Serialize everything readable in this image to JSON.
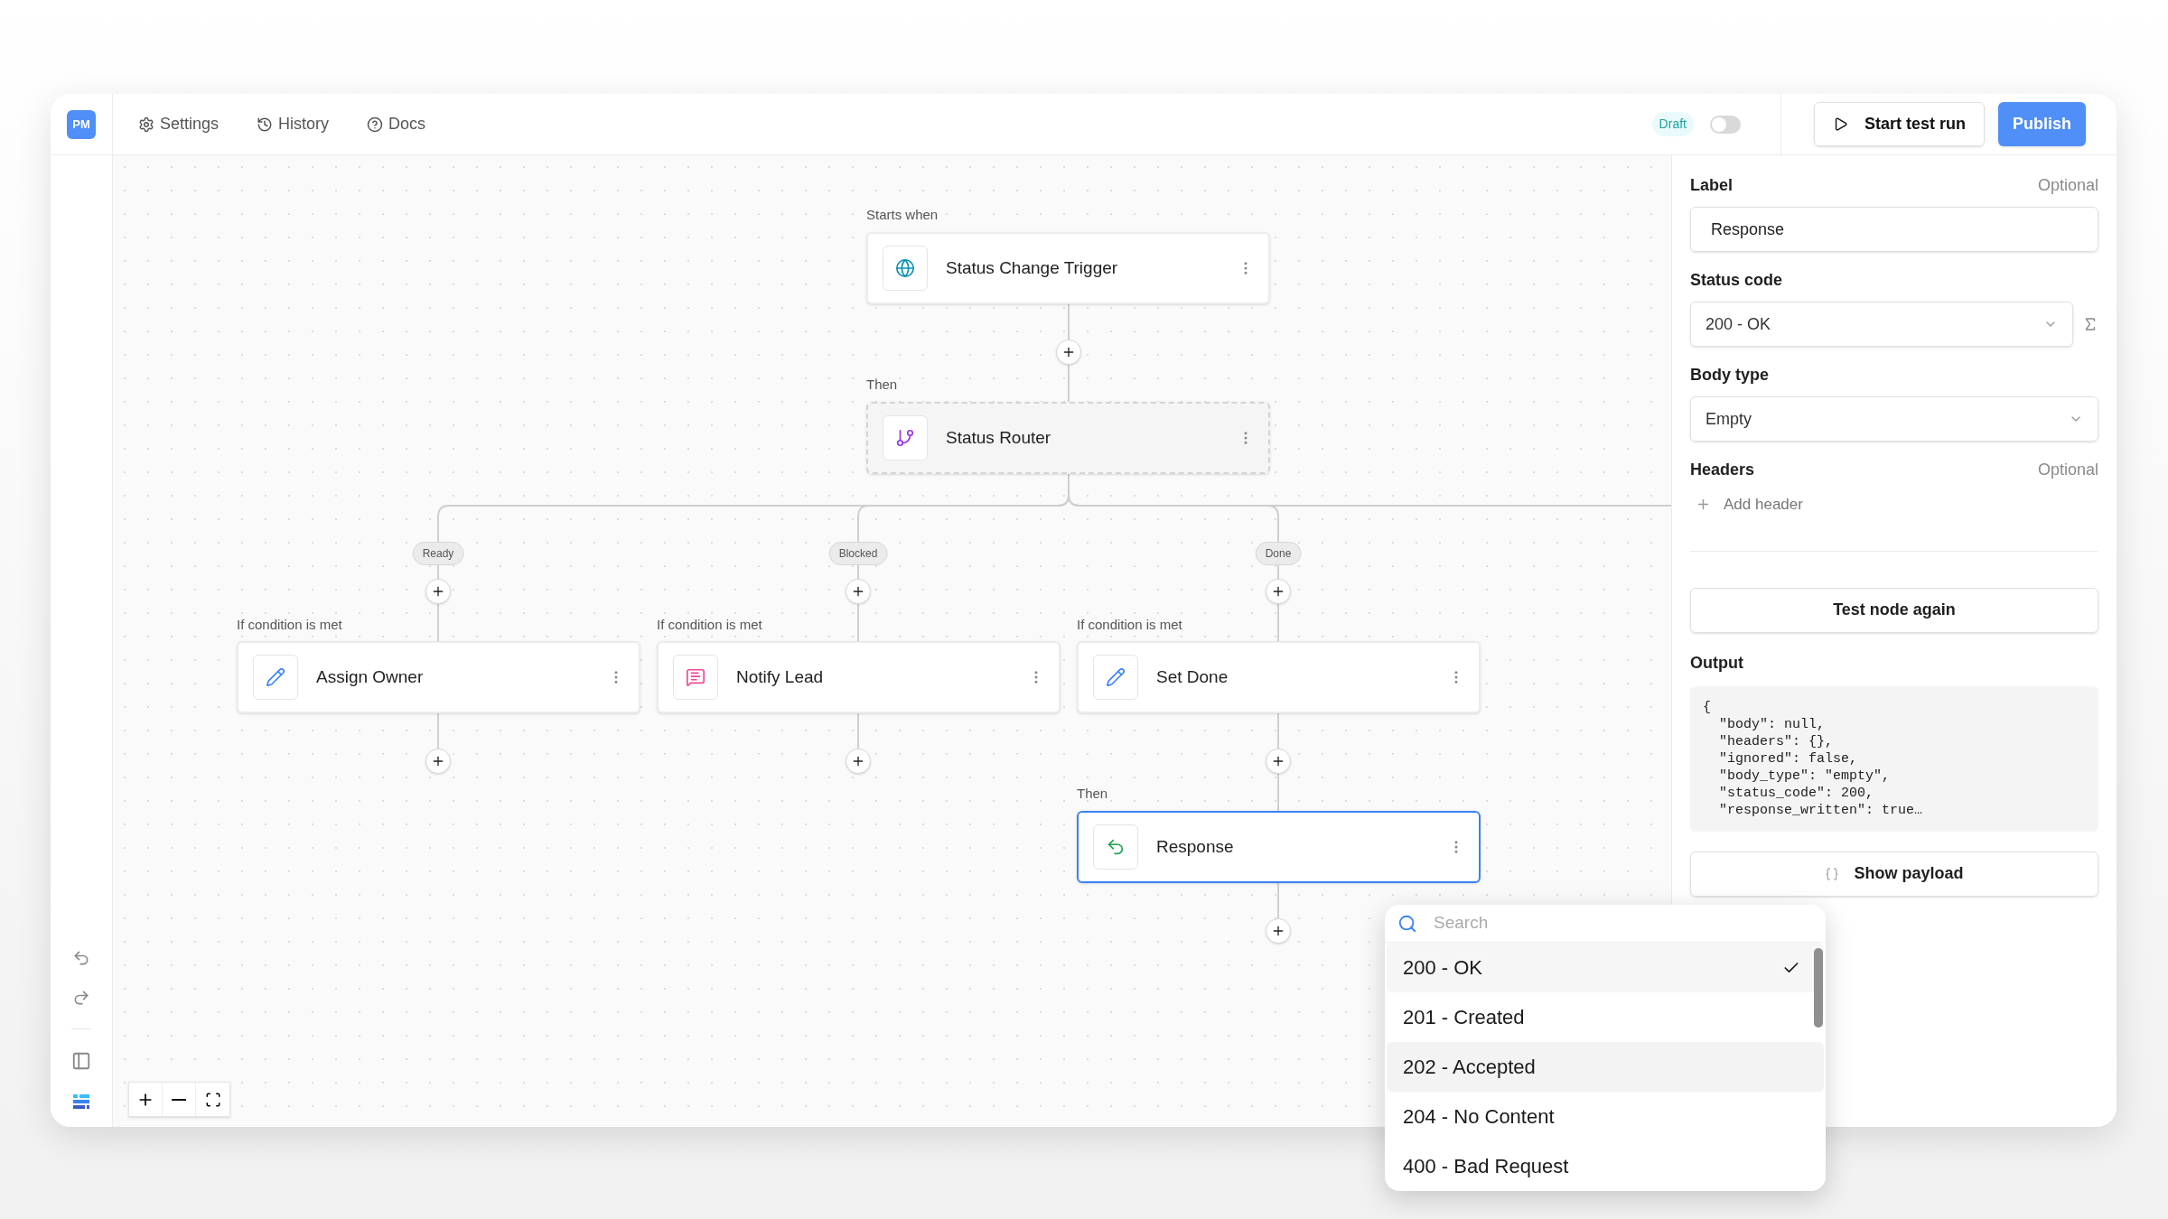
{
  "app": {
    "logo": "PM"
  },
  "nav": [
    {
      "kind": "settings",
      "label": "Settings"
    },
    {
      "kind": "history",
      "label": "History"
    },
    {
      "kind": "docs",
      "label": "Docs"
    }
  ],
  "status_badge": "Draft",
  "publish_toggle": {
    "on": false
  },
  "actions": {
    "test_run": "Start test run",
    "publish": "Publish"
  },
  "flow": {
    "trigger": {
      "caption": "Starts when",
      "kind": "trigger",
      "title": "Status Change Trigger",
      "selected": false
    },
    "router": {
      "caption": "Then",
      "kind": "router",
      "title": "Status Router",
      "selected": false
    },
    "branches": [
      {
        "badge": "Ready",
        "caption": "If condition is met",
        "node": {
          "kind": "action",
          "title": "Assign Owner",
          "selected": false
        }
      },
      {
        "badge": "Blocked",
        "caption": "If condition is met",
        "node": {
          "kind": "notify",
          "title": "Notify Lead",
          "selected": false
        }
      },
      {
        "badge": "Done",
        "caption": "If condition is met",
        "node": {
          "kind": "action",
          "title": "Set Done",
          "selected": false
        },
        "next": {
          "caption": "Then",
          "kind": "response",
          "title": "Response",
          "selected": true
        }
      }
    ]
  },
  "panel": {
    "label": {
      "title": "Label",
      "hint": "Optional",
      "value": "Response"
    },
    "status_code": {
      "title": "Status code",
      "value": "200 - OK"
    },
    "body_type": {
      "title": "Body type",
      "value": "Empty"
    },
    "headers": {
      "title": "Headers",
      "hint": "Optional",
      "add": "Add header"
    },
    "test_button": "Test node again",
    "output": {
      "title": "Output",
      "code": "{\n  \"body\": null,\n  \"headers\": {},\n  \"ignored\": false,\n  \"body_type\": \"empty\",\n  \"status_code\": 200,\n  \"response_written\": true…"
    },
    "payload_button": "Show payload"
  },
  "status_menu": {
    "search": {
      "placeholder": "Search"
    },
    "options": [
      {
        "label": "200 - OK",
        "selected": true,
        "highlighted": false
      },
      {
        "label": "201 - Created",
        "selected": false,
        "highlighted": false
      },
      {
        "label": "202 - Accepted",
        "selected": false,
        "highlighted": true
      },
      {
        "label": "204 - No Content",
        "selected": false,
        "highlighted": false
      },
      {
        "label": "400 - Bad Request",
        "selected": false,
        "highlighted": false
      }
    ]
  }
}
